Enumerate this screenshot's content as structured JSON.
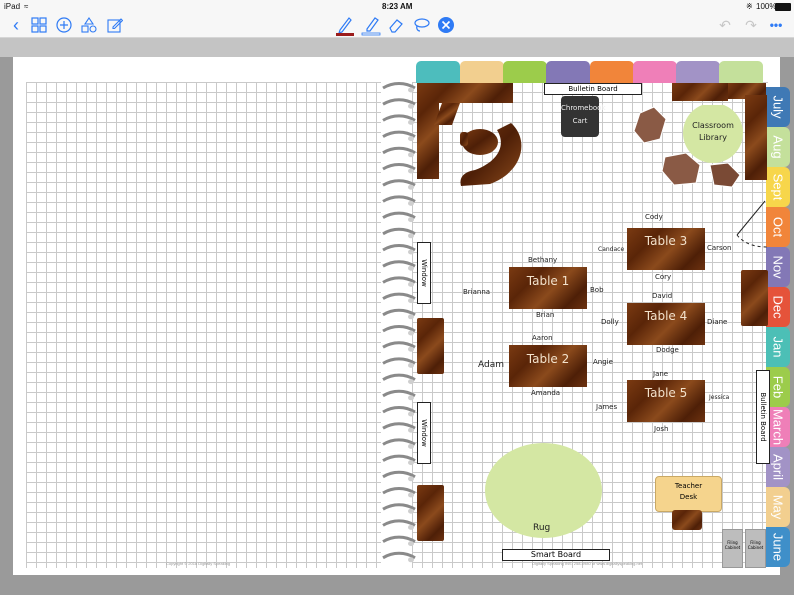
{
  "status": {
    "device": "iPad",
    "time": "8:23 AM",
    "battery": "100%"
  },
  "toolbar": {
    "left_icons": [
      "back-chevron-icon",
      "thumbnails-grid-icon",
      "add-circle-icon",
      "shapes-icon",
      "edit-square-icon"
    ],
    "center_tools": [
      "pen-icon",
      "highlighter-icon",
      "eraser-icon",
      "lasso-icon",
      "close-circle-icon"
    ],
    "right_icons": [
      "undo-icon",
      "redo-icon",
      "more-icon"
    ]
  },
  "months": [
    "July",
    "Aug",
    "Sept",
    "Oct",
    "Nov",
    "Dec",
    "Jan",
    "Feb",
    "March",
    "April",
    "May",
    "June"
  ],
  "colors": {
    "accent": "#2f7bf5",
    "pen_red": "#9b1b1b",
    "teal": "#4dbdbd",
    "peach": "#f2cf8f",
    "green": "#9ccc4b",
    "purple": "#8378b6",
    "orange": "#f1853a",
    "pink": "#ef7fb8",
    "lavender": "#a293c6",
    "lime": "#c4e09b",
    "blue": "#3f79b5",
    "yellow": "#f7d64b",
    "tealmonth": "#4cbfb6",
    "rug": "#d4e7a3"
  },
  "room": {
    "bulletin_top": "Bulletin Board",
    "bulletin_side": "Bulletin Board",
    "chromebook": "Chromebook Cart",
    "library": "Classroom Library",
    "window1": "Window",
    "window2": "Window",
    "smart_board": "Smart Board",
    "rug": "Rug",
    "teacher_desk": "Teacher Desk",
    "filing1": "Filing Cabinet",
    "filing2": "Filing Cabinet"
  },
  "tables": [
    {
      "label": "Table 1",
      "students": {
        "top": "Bethany",
        "left": "Brianna",
        "right": "Bob",
        "bottom": "Brian"
      }
    },
    {
      "label": "Table 2",
      "students": {
        "top": "Aaron",
        "left": "Adam",
        "right": "Angie",
        "bottom": "Amanda"
      }
    },
    {
      "label": "Table 3",
      "students": {
        "top": "Cody",
        "left": "Candace",
        "right": "Carson",
        "bottom": "Cory"
      }
    },
    {
      "label": "Table 4",
      "students": {
        "top": "David",
        "left": "Dolly",
        "right": "Diane",
        "bottom": "Dodge"
      }
    },
    {
      "label": "Table 5",
      "students": {
        "top": "Jane",
        "left": "James",
        "right": "Jessica",
        "bottom": "Josh"
      }
    }
  ],
  "copyright_left": "Copyright © 2018 Digitally Speaking",
  "copyright_right": "Digitally Speaking INS: 258-0980 or www.digitallyspeaking.net"
}
